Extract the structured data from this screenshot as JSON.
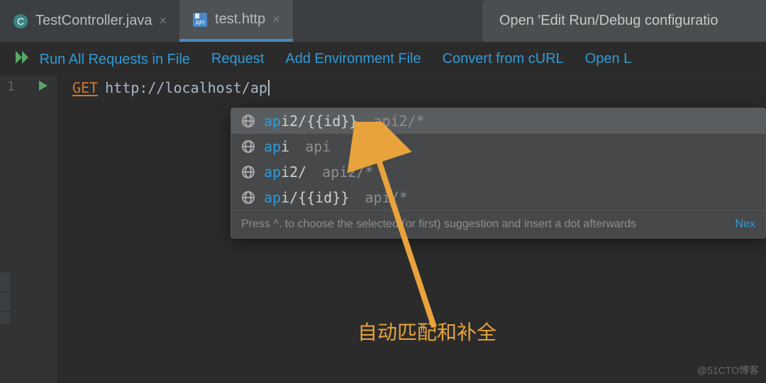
{
  "tabs": [
    {
      "label": "TestController.java",
      "active": false,
      "icon": "java"
    },
    {
      "label": "test.http",
      "active": true,
      "icon": "api"
    }
  ],
  "banner": {
    "text": "Open 'Edit Run/Debug configuratio"
  },
  "toolbar": {
    "run_all": "Run All Requests in File",
    "request": "Request",
    "add_env": "Add Environment File",
    "convert": "Convert from cURL",
    "open": "Open L"
  },
  "editor": {
    "line_no": "1",
    "method": "GET",
    "url": "http://localhost/ap"
  },
  "completion": {
    "items": [
      {
        "match": "ap",
        "rest": "i2/{{id}}",
        "hint": "api2/*",
        "selected": true
      },
      {
        "match": "ap",
        "rest": "i",
        "hint": "api",
        "selected": false
      },
      {
        "match": "ap",
        "rest": "i2/",
        "hint": "api2/*",
        "selected": false
      },
      {
        "match": "ap",
        "rest": "i/{{id}}",
        "hint": "api/*",
        "selected": false
      }
    ],
    "footer_hint": "Press ^. to choose the selected (or first) suggestion and insert a dot afterwards",
    "footer_next": "Nex"
  },
  "annotation": {
    "label": "自动匹配和补全"
  },
  "watermark": "@51CTO博客"
}
